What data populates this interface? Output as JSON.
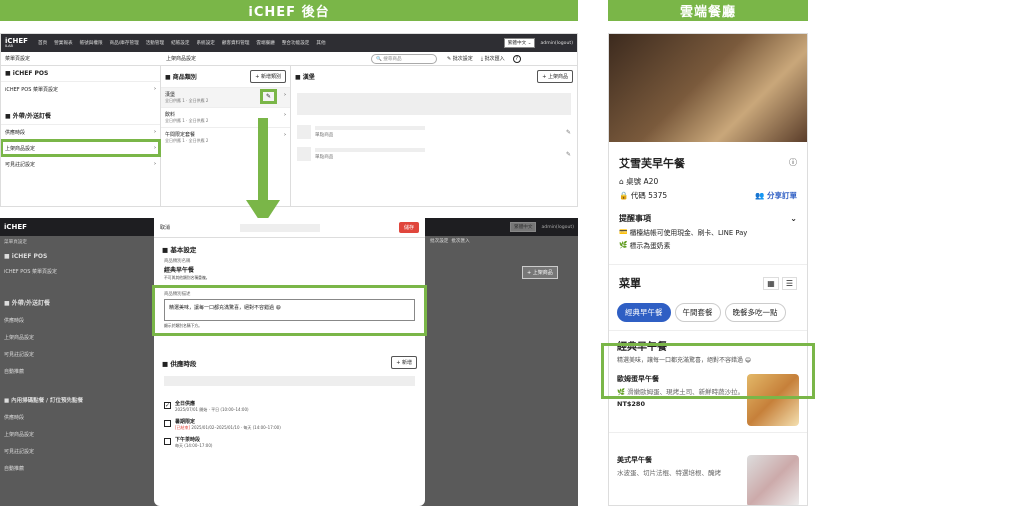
{
  "banners": {
    "left": "iCHEF 後台",
    "right": "雲端餐廳"
  },
  "admin": {
    "logo": "iCHEF",
    "logo_sub": "ILAB",
    "nav": [
      "首頁",
      "營業報表",
      "帳號與權限",
      "商品/庫存管理",
      "活動管理",
      "結帳設定",
      "系統設定",
      "顧客資料管理",
      "雲端餐廳",
      "整合功能設定",
      "其他"
    ],
    "lang": "繁體中文",
    "user": "admin(logout)",
    "bar_left": "菜單頁設定",
    "bar_mid": "上架商品設定",
    "search": "搜尋商品",
    "batch_set": "批次設定",
    "batch_import": "批次匯入",
    "help": "?",
    "side": {
      "pos_head": "■ iCHEF POS",
      "pos_item": "iCHEF POS 菜單頁設定",
      "takeout_head": "■ 外帶/外送訂餐",
      "items": [
        "供應時段",
        "上架商品設定",
        "可見註記設定"
      ]
    },
    "cat_head": "■ 商品類別",
    "add_cat": "+ 新增類別",
    "cats": [
      {
        "name": "漢堡",
        "sub": "全日供應 1 · 全日供應 2"
      },
      {
        "name": "飲料",
        "sub": "全日供應 1 · 全日供應 2"
      },
      {
        "name": "午間限定套餐",
        "sub": "全日供應 1 · 全日供應 2"
      }
    ],
    "prod_head": "■ 漢堡",
    "add_prod": "+ 上架商品",
    "prod_label": "單點商品"
  },
  "admin2": {
    "side": [
      "■ iCHEF POS",
      "iCHEF POS 菜單頁設定",
      "■ 外帶/外送訂餐",
      "供應時段",
      "上架商品設定",
      "可見註記設定",
      "自動推薦",
      "■ 內用掃碼點餐 / 訂位預先點餐",
      "供應時段",
      "上架商品設定",
      "可見註記設定",
      "自動推薦"
    ],
    "cancel": "取消",
    "save": "儲存",
    "basic": "■ 基本設定",
    "name_lbl": "商品類別名稱",
    "name_val": "經典早午餐",
    "name_hint": "不可與其他類別名稱重複。",
    "desc_lbl": "商品類別描述",
    "desc_val": "精選美味，讓每一口都充滿驚喜，絕對不容錯過 😄",
    "desc_hint": "顯示於類別名稱下方。",
    "period": "■ 供應時段",
    "add": "+ 新增",
    "periods": [
      {
        "mark": "✓",
        "name": "全日供應",
        "note": "",
        "desc": "2025/07/01 開始 · 平日 (10:00–14:00)"
      },
      {
        "mark": "",
        "name": "暑期限定",
        "note": "[已結束]",
        "desc": " 2025/01/02–2025/01/10 · 每天 (14:00–17:00)"
      },
      {
        "mark": "",
        "name": "下午茶時段",
        "note": "",
        "desc": "每天 (14:00–17:00)"
      }
    ]
  },
  "phone": {
    "name": "艾雪芙早午餐",
    "table": "桌號 A20",
    "code": "代碼 5375",
    "share": "分享訂單",
    "notice": "提醒事項",
    "notice1": "櫃檯結帳可使用現金、刷卡、LINE Pay",
    "notice2": "標示為蛋奶素",
    "menu": "菜單",
    "chips": [
      "經典早午餐",
      "午間套餐",
      "晚餐多吃一點"
    ],
    "cat_title": "經典早午餐",
    "cat_desc": "精選美味，讓每一口都充滿驚喜，絕對不容錯過 😄",
    "foods": [
      {
        "name": "歐姆蛋早午餐",
        "desc": "滑嫩歐姆蛋、現烤土司、新鮮時蔬沙拉。",
        "price": "NT$280"
      },
      {
        "name": "美式早午餐",
        "desc": "水波蛋、切片法棍、特選培根、醃烤",
        "price": ""
      }
    ]
  },
  "colors": {
    "accent": "#7ab648",
    "blue": "#2f5fc4",
    "red": "#e0463c"
  }
}
